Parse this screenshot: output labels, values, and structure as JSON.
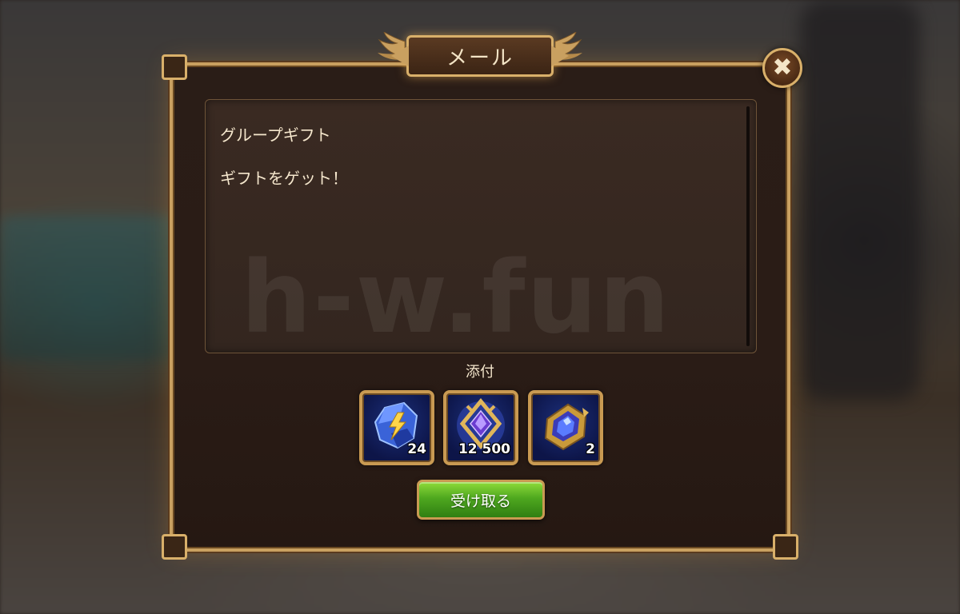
{
  "dialog": {
    "title": "メール",
    "close_icon": "close-icon",
    "accent_color": "#c9a060"
  },
  "message": {
    "subject": "グループギフト",
    "body": "ギフトをゲット！",
    "watermark": "h-w.fun"
  },
  "attachments": {
    "label": "添付",
    "items": [
      {
        "icon": "blue-crystal-lightning-icon",
        "count": "24"
      },
      {
        "icon": "gold-frame-gem-emblem-icon",
        "count": "12 500"
      },
      {
        "icon": "purple-gem-artifact-icon",
        "count": "2"
      }
    ]
  },
  "claim_button": {
    "label": "受け取る",
    "color": "#4fa81f"
  }
}
